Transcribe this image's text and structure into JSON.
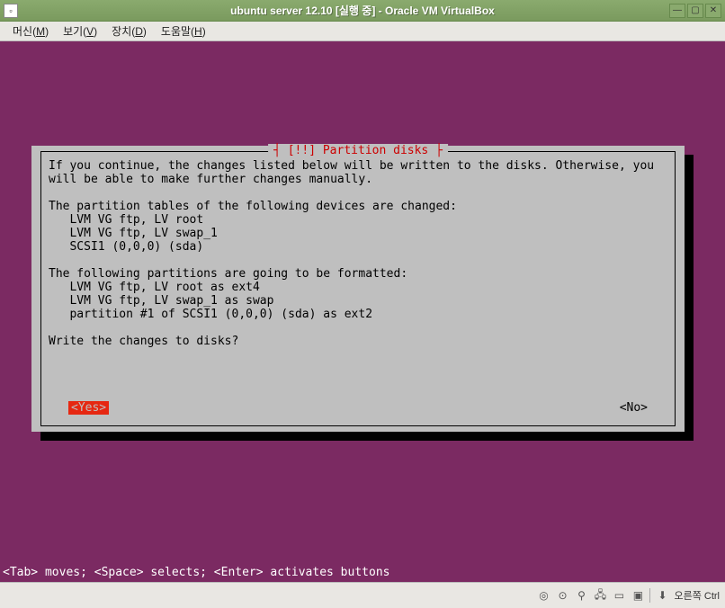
{
  "window": {
    "title": "ubuntu server 12.10 [실행 중] - Oracle VM VirtualBox",
    "icon_label": "VBox"
  },
  "menubar": {
    "items": [
      {
        "pre": "머신(",
        "key": "M",
        "post": ")"
      },
      {
        "pre": "보기(",
        "key": "V",
        "post": ")"
      },
      {
        "pre": "장치(",
        "key": "D",
        "post": ")"
      },
      {
        "pre": "도움말(",
        "key": "H",
        "post": ")"
      }
    ]
  },
  "dialog": {
    "title": "[!!] Partition disks",
    "body": "If you continue, the changes listed below will be written to the disks. Otherwise, you\nwill be able to make further changes manually.\n\nThe partition tables of the following devices are changed:\n   LVM VG ftp, LV root\n   LVM VG ftp, LV swap_1\n   SCSI1 (0,0,0) (sda)\n\nThe following partitions are going to be formatted:\n   LVM VG ftp, LV root as ext4\n   LVM VG ftp, LV swap_1 as swap\n   partition #1 of SCSI1 (0,0,0) (sda) as ext2\n\nWrite the changes to disks?",
    "yes": "<Yes>",
    "no": "<No>"
  },
  "hint": "<Tab> moves; <Space> selects; <Enter> activates buttons",
  "statusbar": {
    "capture_text": "오른쪽 Ctrl"
  }
}
